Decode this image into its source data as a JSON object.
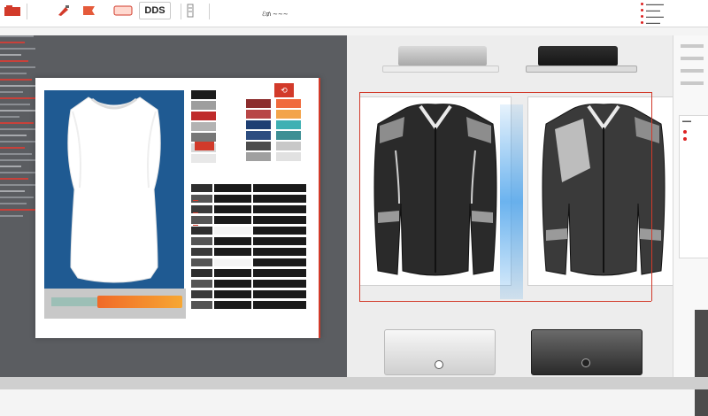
{
  "toolbar": {
    "logo_text": "DDS",
    "status_text": "ℰ₥ ∼∼∼",
    "menu": [
      "▬▬▬▬▬",
      "▬▬▬▬",
      "▬▬▬▬▬",
      "▬▬▬▬"
    ]
  },
  "colors": {
    "accent": "#d23a2a",
    "dark_panel": "#5b5d61",
    "preview_blue": "#1f5a92",
    "jacket_dark": "#2a2a2a",
    "glow_blue": "#59aaeb"
  },
  "editor": {
    "badge_text": "⟲"
  },
  "sidebar": {
    "card_text": "▬▬"
  }
}
